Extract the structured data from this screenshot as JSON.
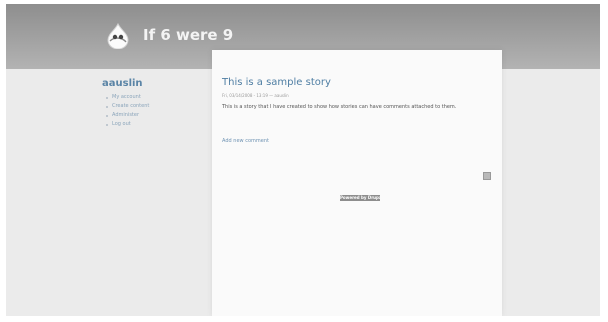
{
  "site": {
    "name": "If 6 were 9",
    "logo_icon": "drupal-drop-icon"
  },
  "sidebar": {
    "title": "aauslin",
    "items": [
      {
        "label": "My account"
      },
      {
        "label": "Create content"
      },
      {
        "label": "Administer"
      },
      {
        "label": "Log out"
      }
    ]
  },
  "node": {
    "title": "This is a sample story",
    "submitted": "Fri, 03/14/2008 - 13:19 — aauslin",
    "body": "This is a story that I have created to show how stories can have comments attached to them.",
    "links": {
      "add_comment": "Add new comment"
    }
  },
  "footer": {
    "feed_icon": "rss-feed-icon",
    "badge_label": "Powered by Drupal"
  },
  "colors": {
    "link": "#5a84a6",
    "header": "#9a9a9a",
    "background": "#ebebeb"
  }
}
